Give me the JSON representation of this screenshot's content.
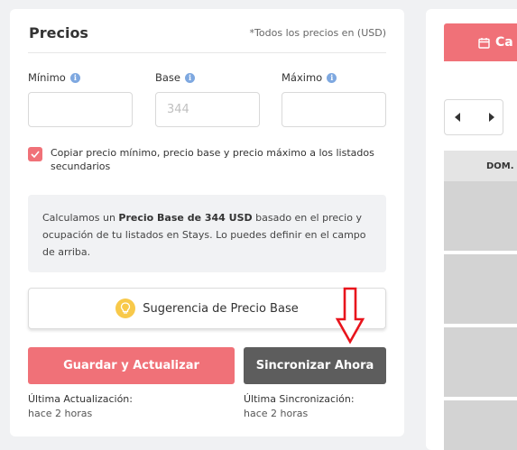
{
  "precios": {
    "title": "Precios",
    "note": "*Todos los precios en (USD)",
    "fields": {
      "minimo": {
        "label": "Mínimo",
        "value": "",
        "placeholder": ""
      },
      "base": {
        "label": "Base",
        "value": "",
        "placeholder": "344"
      },
      "maximo": {
        "label": "Máximo",
        "value": "",
        "placeholder": ""
      }
    },
    "copy_checkbox": {
      "checked": true,
      "label": "Copiar precio mínimo, precio base y precio máximo a los listados secundarios"
    },
    "info": {
      "prefix": "Calculamos un ",
      "bold": "Precio Base de 344 USD",
      "suffix": " basado en el precio y ocupación de tu listados en Stays. Lo puedes definir en el campo de arriba."
    },
    "suggestion_button": "Sugerencia de Precio Base",
    "save_button": "Guardar y Actualizar",
    "sync_button": "Sincronizar Ahora",
    "last_update": {
      "label": "Última Actualización:",
      "value": "hace 2 horas"
    },
    "last_sync": {
      "label": "Última Sincronización:",
      "value": "hace 2 horas"
    }
  },
  "calendar": {
    "button_label": "Ca",
    "day_header": "DOM."
  },
  "icons": {
    "info": "info-icon",
    "check": "check-icon",
    "bulb": "lightbulb-icon",
    "arrow": "arrow-down-annotation",
    "calendar": "calendar-icon",
    "prev": "chevron-left-icon",
    "next": "chevron-right-icon"
  },
  "colors": {
    "accent": "#f07178",
    "sync": "#5d5d5d",
    "info_dot": "#7ea8e0",
    "bulb": "#f8c94a",
    "annotation_arrow": "#e8141c"
  }
}
